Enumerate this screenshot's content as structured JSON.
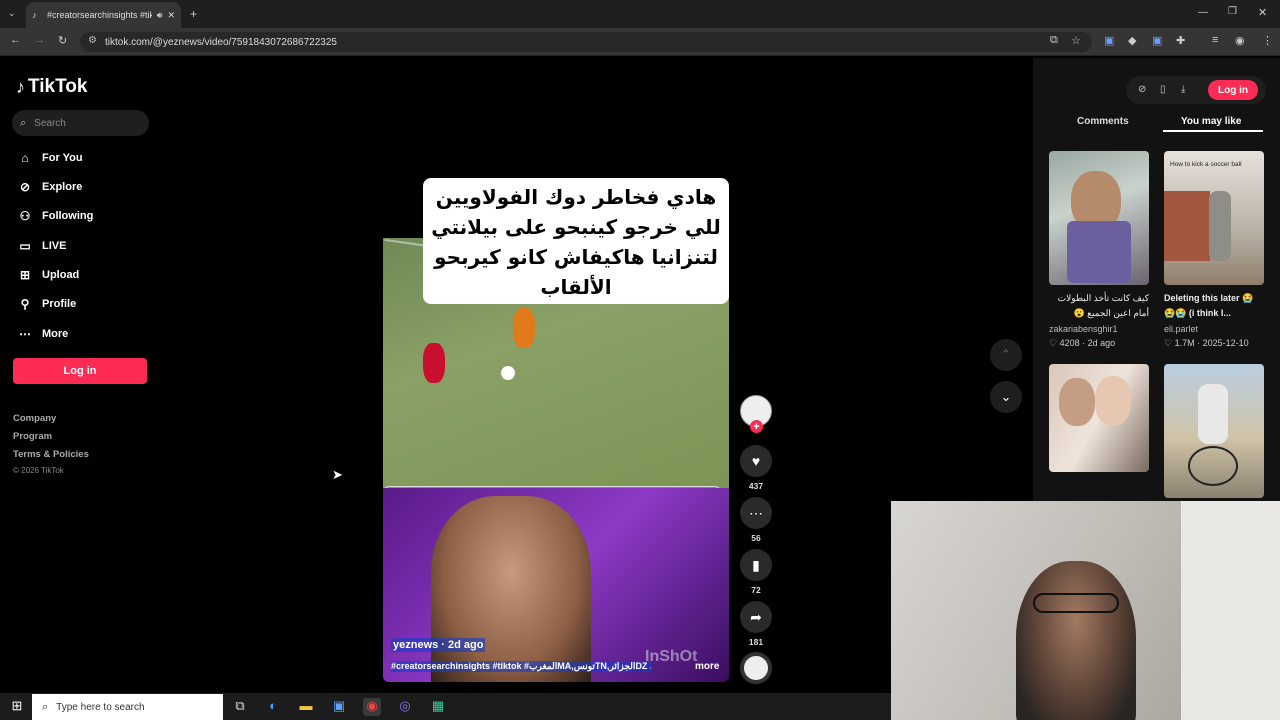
{
  "browser": {
    "tab_title": "#creatorsearchinsights #tikt",
    "url": "tiktok.com/@yeznews/video/7591843072686722325"
  },
  "sidebar": {
    "logo": "TikTok",
    "search_placeholder": "Search",
    "nav": [
      {
        "label": "For You",
        "icon": "home-icon"
      },
      {
        "label": "Explore",
        "icon": "compass-icon"
      },
      {
        "label": "Following",
        "icon": "person-icon"
      },
      {
        "label": "LIVE",
        "icon": "live-icon"
      },
      {
        "label": "Upload",
        "icon": "upload-icon"
      },
      {
        "label": "Profile",
        "icon": "profile-icon"
      },
      {
        "label": "More",
        "icon": "more-icon"
      }
    ],
    "login": "Log in",
    "footer": [
      "Company",
      "Program",
      "Terms & Policies"
    ],
    "copyright": "© 2026 TikTok"
  },
  "video": {
    "caption": "هادي فخاطر دوك الفولاويين للي خرجو كينبحو على بيلانتي لتنزانيا هاكيفاش كانو كيربحو الألقاب",
    "author": "yeznews · 2d ago",
    "tags": "#creatorsearchinsights #tiktok #المغربMA,تونسTN,الجزائرDZ ...",
    "more": "more"
  },
  "actions": {
    "likes": "437",
    "comments": "56",
    "saves": "72",
    "shares": "181"
  },
  "right_panel": {
    "login": "Log in",
    "tabs": [
      "Comments",
      "You may like"
    ],
    "cards": [
      {
        "title": "كيف كانت تأخذ البطولات أمام اعين الجميع 😮",
        "user": "zakariabensghir1",
        "likes": "4208",
        "date": "2d ago",
        "thumb_text": ""
      },
      {
        "title": "Deleting this later 😭😭😭 (i think I...",
        "user": "eli.parlet",
        "likes": "1.7M",
        "date": "2025-12-10",
        "thumb_text": "How to kick a soccer ball"
      }
    ]
  },
  "taskbar": {
    "search_placeholder": "Type here to search"
  },
  "colors": {
    "brand": "#fe2c55",
    "background": "#000000"
  }
}
